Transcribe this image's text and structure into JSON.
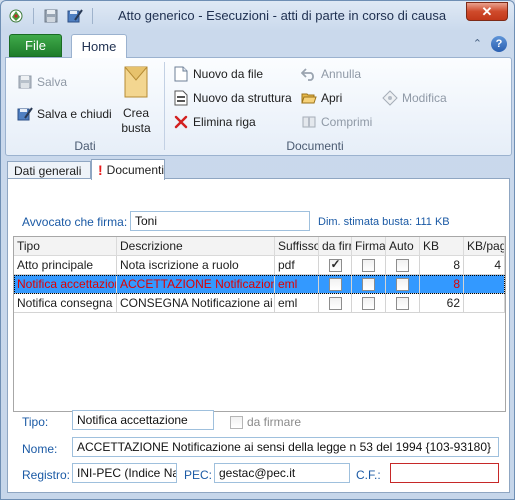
{
  "window": {
    "title": "Atto generico - Esecuzioni - atti di parte in corso di causa",
    "close_glyph": "✕"
  },
  "ribbon_tabs": {
    "file": "File",
    "home": "Home"
  },
  "ribbon": {
    "dati": {
      "label": "Dati",
      "salva": "Salva",
      "salva_e_chiudi": "Salva e chiudi",
      "crea_busta_1": "Crea",
      "crea_busta_2": "busta"
    },
    "documenti": {
      "label": "Documenti",
      "nuovo_da_file": "Nuovo da file",
      "nuovo_da_struttura": "Nuovo da struttura",
      "elimina_riga": "Elimina riga",
      "annulla": "Annulla",
      "apri": "Apri",
      "comprimi": "Comprimi",
      "modifica": "Modifica"
    }
  },
  "page_tabs": {
    "dati_generali": "Dati generali",
    "documenti": "Documenti"
  },
  "form": {
    "avvocato_label": "Avvocato che firma:",
    "avvocato_value": "Toni",
    "dim_stimata": "Dim. stimata busta: 111 KB"
  },
  "grid": {
    "columns": [
      "Tipo",
      "Descrizione",
      "Suffisso",
      "da firr",
      "Firma",
      "Auto",
      "KB",
      "KB/pag"
    ],
    "rows": [
      {
        "tipo": "Atto principale",
        "descrizione": "Nota iscrizione a ruolo",
        "suffisso": "pdf",
        "da_firmare": true,
        "firma": false,
        "auto": false,
        "kb": "8",
        "kb_pag": "4",
        "selected": false
      },
      {
        "tipo": "Notifica accettazione",
        "descrizione": "ACCETTAZIONE  Notificazione a",
        "suffisso": "eml",
        "da_firmare": false,
        "firma": false,
        "auto": false,
        "kb": "8",
        "kb_pag": "",
        "selected": true
      },
      {
        "tipo": "Notifica consegna",
        "descrizione": "CONSEGNA  Notificazione ai ser",
        "suffisso": "eml",
        "da_firmare": false,
        "firma": false,
        "auto": false,
        "kb": "62",
        "kb_pag": "",
        "selected": false
      }
    ]
  },
  "detail": {
    "tipo_label": "Tipo:",
    "tipo_value": "Notifica accettazione",
    "da_firmare_label": "da firmare",
    "nome_label": "Nome:",
    "nome_value": "ACCETTAZIONE  Notificazione ai sensi della legge n  53 del 1994 {103-93180}",
    "registro_label": "Registro:",
    "registro_value": "INI-PEC (Indice Nazio",
    "pec_label": "PEC:",
    "pec_value": "gestac@pec.it",
    "cf_label": "C.F.:",
    "cf_value": ""
  },
  "colors": {
    "accent": "#1b5aa5",
    "selection": "#3399ff",
    "file_tab": "#2a8a35",
    "error_border": "#c62828"
  }
}
